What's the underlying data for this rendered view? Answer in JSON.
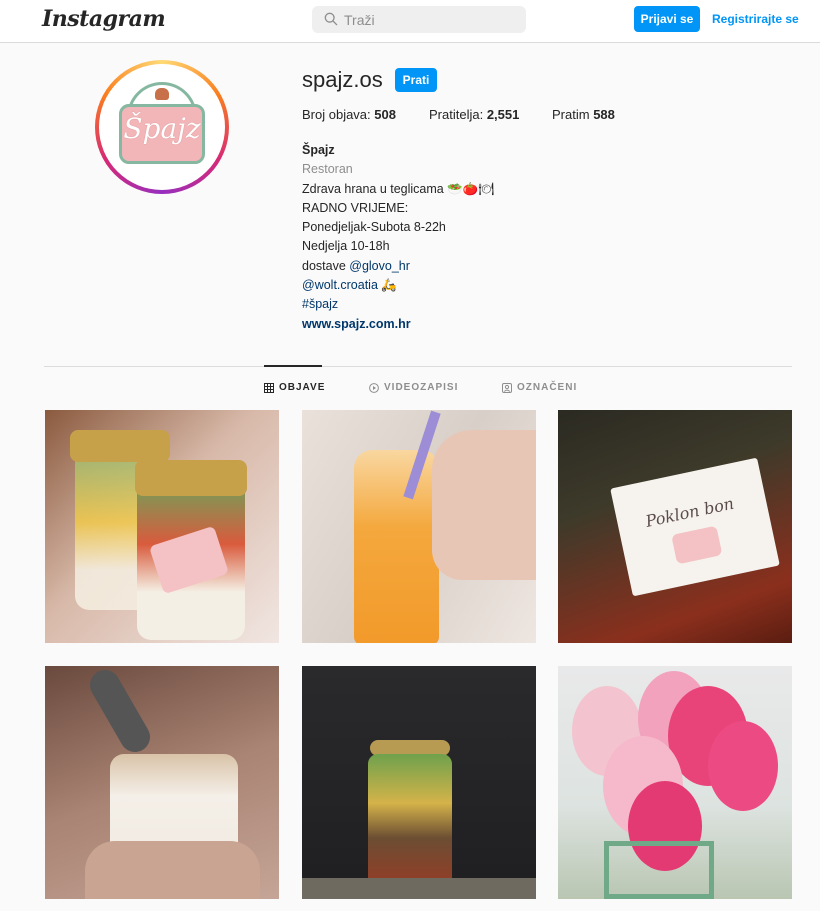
{
  "header": {
    "logo_text": "Instagram",
    "search_placeholder": "Traži",
    "login_label": "Prijavi se",
    "register_label": "Registrirajte se"
  },
  "profile": {
    "avatar_text": "Špajz",
    "username": "spajz.os",
    "follow_label": "Prati",
    "stats": {
      "posts_label": "Broj objava:",
      "posts_value": "508",
      "followers_label": "Pratitelja:",
      "followers_value": "2,551",
      "following_label": "Pratim",
      "following_value": "588"
    },
    "bio": {
      "name": "Špajz",
      "category": "Restoran",
      "line1": "Zdrava hrana u teglicama 🥗🍅🍽",
      "line2": "RADNO VRIJEME:",
      "line3": "Ponedjeljak-Subota 8-22h",
      "line4": "Nedjelja 10-18h",
      "line5_prefix": "dostave ",
      "line5_link": "@glovo_hr",
      "line6_link": "@wolt.croatia",
      "line6_emoji": " 🛵",
      "hashtag": "#špajz",
      "website": "www.spajz.com.hr"
    }
  },
  "tabs": {
    "posts": "OBJAVE",
    "videos": "VIDEOZAPISI",
    "tagged": "OZNAČENI",
    "active": "posts"
  },
  "posts": [
    {
      "alt": "salad-jars"
    },
    {
      "alt": "orange-juice-bottle"
    },
    {
      "alt": "gift-card",
      "overlay_text": "Poklon bon"
    },
    {
      "alt": "dessert-jar"
    },
    {
      "alt": "layered-salad-jar"
    },
    {
      "alt": "pink-balloons"
    }
  ],
  "colors": {
    "primary_blue": "#0095f6",
    "link_blue": "#00376b",
    "border": "#dbdbdb",
    "text": "#262626",
    "muted": "#8e8e8e"
  }
}
